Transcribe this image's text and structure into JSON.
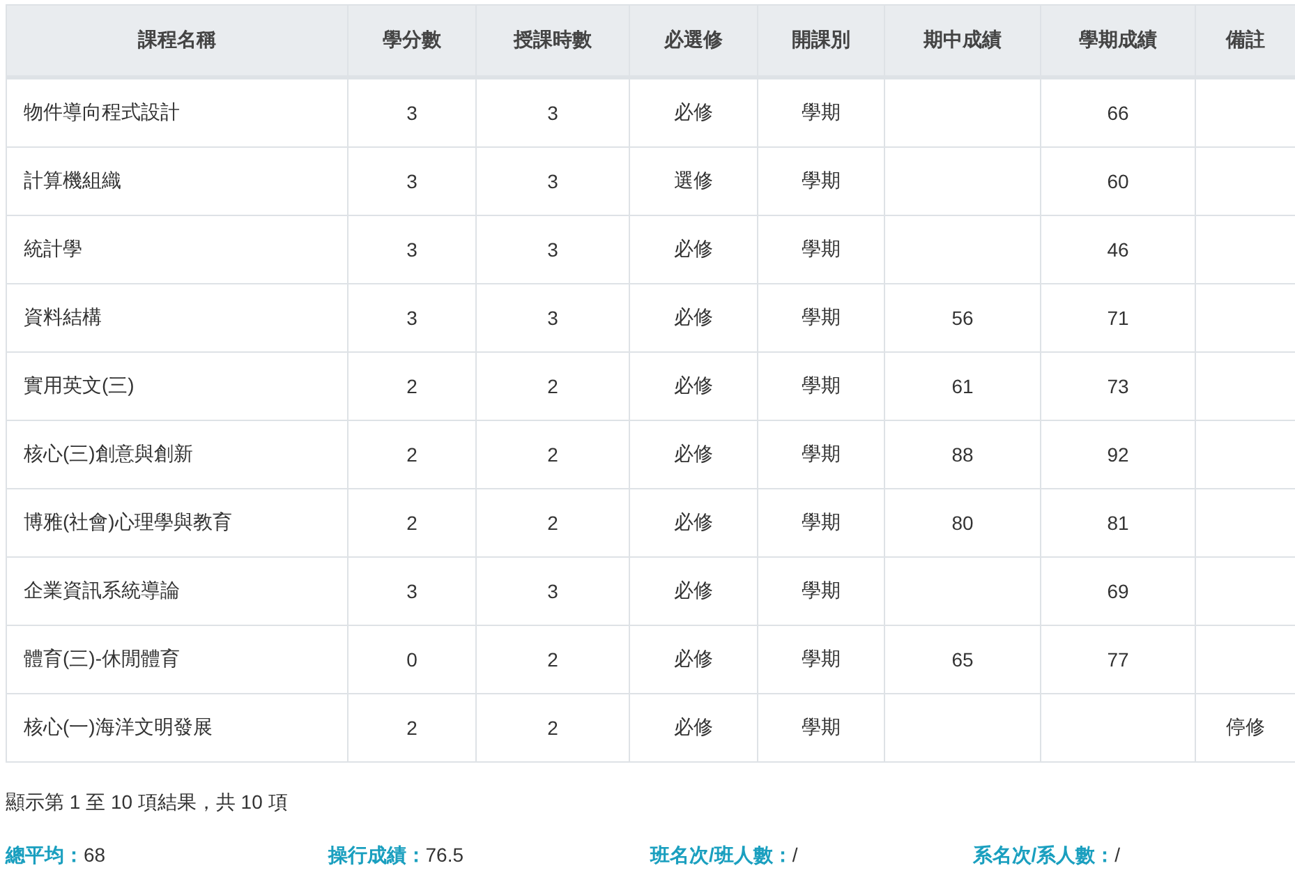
{
  "table": {
    "columns": [
      "課程名稱",
      "學分數",
      "授課時數",
      "必選修",
      "開課別",
      "期中成績",
      "學期成績",
      "備註"
    ],
    "rows": [
      {
        "course": "物件導向程式設計",
        "credits": "3",
        "hours": "3",
        "required": "必修",
        "term": "學期",
        "final": "66"
      },
      {
        "course": "計算機組織",
        "credits": "3",
        "hours": "3",
        "required": "選修",
        "term": "學期",
        "final": "60"
      },
      {
        "course": "統計學",
        "credits": "3",
        "hours": "3",
        "required": "必修",
        "term": "學期",
        "final": "46"
      },
      {
        "course": "資料結構",
        "credits": "3",
        "hours": "3",
        "required": "必修",
        "term": "學期",
        "midterm": "56",
        "final": "71"
      },
      {
        "course": "實用英文(三)",
        "credits": "2",
        "hours": "2",
        "required": "必修",
        "term": "學期",
        "midterm": "61",
        "final": "73"
      },
      {
        "course": "核心(三)創意與創新",
        "credits": "2",
        "hours": "2",
        "required": "必修",
        "term": "學期",
        "midterm": "88",
        "final": "92"
      },
      {
        "course": "博雅(社會)心理學與教育",
        "credits": "2",
        "hours": "2",
        "required": "必修",
        "term": "學期",
        "midterm": "80",
        "final": "81"
      },
      {
        "course": "企業資訊系統導論",
        "credits": "3",
        "hours": "3",
        "required": "必修",
        "term": "學期",
        "final": "69"
      },
      {
        "course": "體育(三)-休閒體育",
        "credits": "0",
        "hours": "2",
        "required": "必修",
        "term": "學期",
        "midterm": "65",
        "final": "77"
      },
      {
        "course": "核心(一)海洋文明發展",
        "credits": "2",
        "hours": "2",
        "required": "必修",
        "term": "學期",
        "note": "停修"
      }
    ]
  },
  "info": "顯示第 1 至 10 項結果，共 10 項",
  "summary": [
    {
      "label": "總平均：",
      "value": "68"
    },
    {
      "label": "操行成績：",
      "value": "76.5"
    },
    {
      "label": "班名次/班人數：",
      "value": "/"
    },
    {
      "label": "系名次/系人數：",
      "value": "/"
    }
  ]
}
